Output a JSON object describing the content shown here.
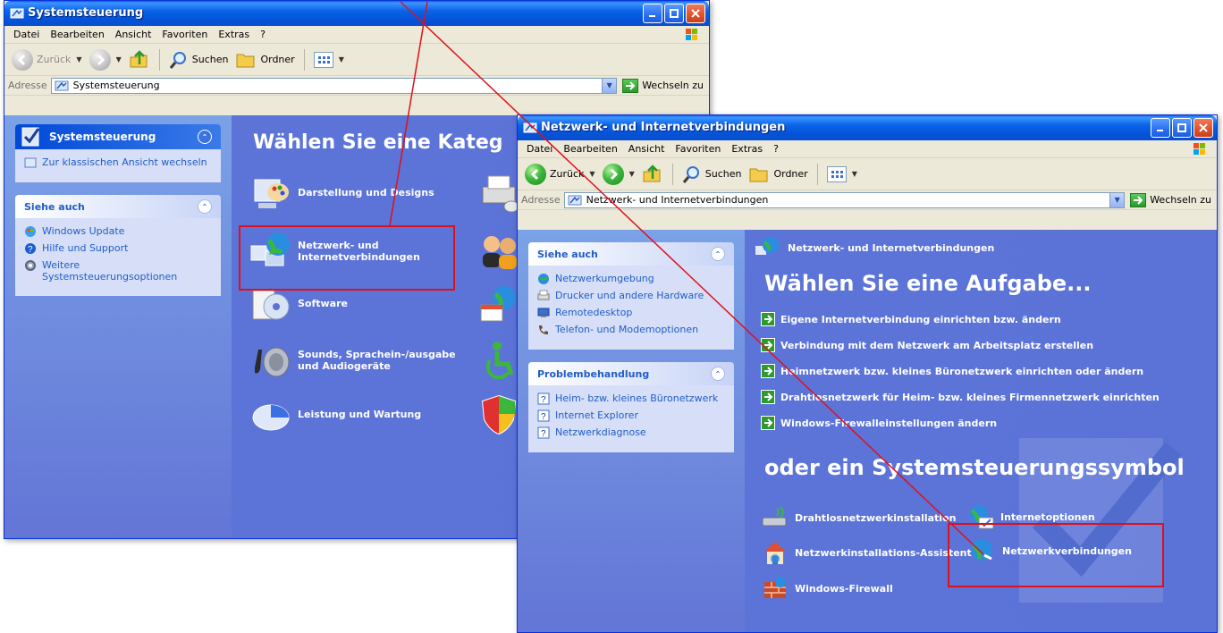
{
  "window1": {
    "title": "Systemsteuerung",
    "menu": [
      "Datei",
      "Bearbeiten",
      "Ansicht",
      "Favoriten",
      "Extras",
      "?"
    ],
    "toolbar": {
      "back": "Zurück",
      "search": "Suchen",
      "folders": "Ordner"
    },
    "address": {
      "label": "Adresse",
      "value": "Systemsteuerung",
      "go": "Wechseln zu"
    },
    "left_panel": {
      "header": "Systemsteuerung",
      "switch_link": "Zur klassischen Ansicht wechseln",
      "see_also_header": "Siehe auch",
      "see_also": [
        "Windows Update",
        "Hilfe und Support",
        "Weitere Systemsteuerungsoptionen"
      ]
    },
    "main": {
      "heading": "Wählen Sie eine Kateg",
      "categories": [
        "Darstellung und Designs",
        "Netzwerk- und Internetverbindungen",
        "Software",
        "Sounds, Sprachein-/ausgabe und Audiogeräte",
        "Leistung und Wartung"
      ]
    }
  },
  "window2": {
    "title": "Netzwerk- und Internetverbindungen",
    "menu": [
      "Datei",
      "Bearbeiten",
      "Ansicht",
      "Favoriten",
      "Extras",
      "?"
    ],
    "toolbar": {
      "back": "Zurück",
      "search": "Suchen",
      "folders": "Ordner"
    },
    "address": {
      "label": "Adresse",
      "value": "Netzwerk- und Internetverbindungen",
      "go": "Wechseln zu"
    },
    "left_panel": {
      "see_also_header": "Siehe auch",
      "see_also": [
        "Netzwerkumgebung",
        "Drucker und andere Hardware",
        "Remotedesktop",
        "Telefon- und Modemoptionen"
      ],
      "troubleshoot_header": "Problembehandlung",
      "troubleshoot": [
        "Heim- bzw. kleines Büronetzwerk",
        "Internet Explorer",
        "Netzwerkdiagnose"
      ]
    },
    "main": {
      "breadcrumb": "Netzwerk- und Internetverbindungen",
      "heading": "Wählen Sie eine Aufgabe...",
      "tasks": [
        "Eigene Internetverbindung einrichten bzw. ändern",
        "Verbindung mit dem Netzwerk am Arbeitsplatz erstellen",
        "Heimnetzwerk bzw. kleines Büronetzwerk einrichten oder ändern",
        "Drahtlosnetzwerk für Heim- bzw. kleines Firmennetzwerk einrichten",
        "Windows-Firewalleinstellungen ändern"
      ],
      "subheading": "oder ein Systemsteuerungssymbol",
      "icons": [
        "Drahtlosnetzwerkinstallation",
        "Internetoptionen",
        "Netzwerkinstallations-Assistent",
        "Netzwerkverbindungen",
        "Windows-Firewall"
      ]
    }
  },
  "colors": {
    "highlight": "#e0101a",
    "xp_blue": "#0a5fe8",
    "pane_blue": "#5b72d6",
    "link_blue": "#215dc6"
  }
}
